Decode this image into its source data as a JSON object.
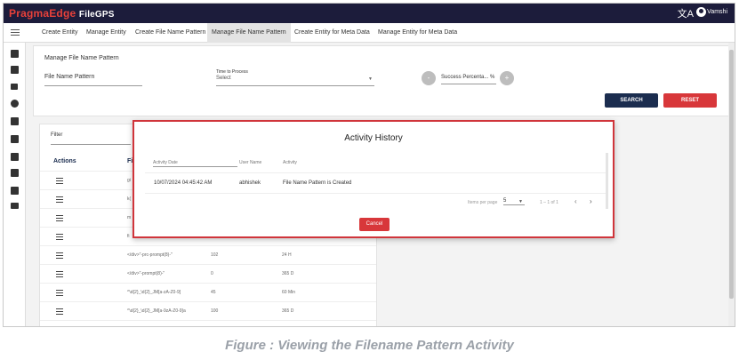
{
  "app": {
    "brand_left": "PragmaEdge",
    "brand_right": "FileGPS",
    "translate_glyph": "文A",
    "user_name": "Vamshi"
  },
  "nav": {
    "tabs": [
      {
        "label": "Create Entity",
        "active": false
      },
      {
        "label": "Manage Entity",
        "active": false
      },
      {
        "label": "Create File Name Pattern",
        "active": false
      },
      {
        "label": "Manage File Name Pattern",
        "active": true
      },
      {
        "label": "Create Entity for Meta Data",
        "active": false
      },
      {
        "label": "Manage Entity for Meta Data",
        "active": false
      }
    ]
  },
  "filters": {
    "title": "Manage File Name Pattern",
    "file_name_pattern_label": "File Name Pattern",
    "time_to_process_label": "Time to Process",
    "time_to_process_value": "Select",
    "success_percentage_label": "Success Percenta... %",
    "minus": "-",
    "plus": "+",
    "search_label": "SEARCH",
    "reset_label": "RESET"
  },
  "table": {
    "filter_label": "Filter",
    "actions_header": "Actions",
    "second_header_partial": "Fi",
    "rows": [
      {
        "c1": "gi",
        "c2": "",
        "c3": ""
      },
      {
        "c1": "k(",
        "c2": "",
        "c3": ""
      },
      {
        "c1": "m",
        "c2": "",
        "c3": ""
      },
      {
        "c1": "fi",
        "c2": "",
        "c3": ""
      },
      {
        "c1": "</div>\"-prc-prompt(8)-\"",
        "c2": "102",
        "c3": "24 H"
      },
      {
        "c1": "</div>\"-prompt(8)-\"",
        "c2": "0",
        "c3": "365 D"
      },
      {
        "c1": "^\\d{2}_\\d{2}_JM[a-zA-Z0-9]",
        "c2": "45",
        "c3": "60 Min"
      },
      {
        "c1": "^\\d{2}_\\d{2}_JM[a-9zA-Z0-9]a",
        "c2": "100",
        "c3": "365 D"
      }
    ]
  },
  "modal": {
    "title": "Activity History",
    "headers": {
      "date": "Activity Date",
      "user": "User Name",
      "activity": "Activity"
    },
    "rows": [
      {
        "date": "10/07/2024 04:45:42 AM",
        "user": "abhishek",
        "activity": "File Name Pattern is Created"
      }
    ],
    "items_per_page_label": "Items per page",
    "items_per_page_value": "5",
    "range_label": "1 – 1 of 1",
    "cancel_label": "Cancel"
  },
  "caption": "Figure : Viewing the Filename Pattern Activity",
  "colors": {
    "topbar": "#1c1c3b",
    "brand_red": "#e8413a",
    "search_button": "#1b2d4f",
    "reset_button": "#d8373a",
    "modal_border": "#d0353b"
  }
}
